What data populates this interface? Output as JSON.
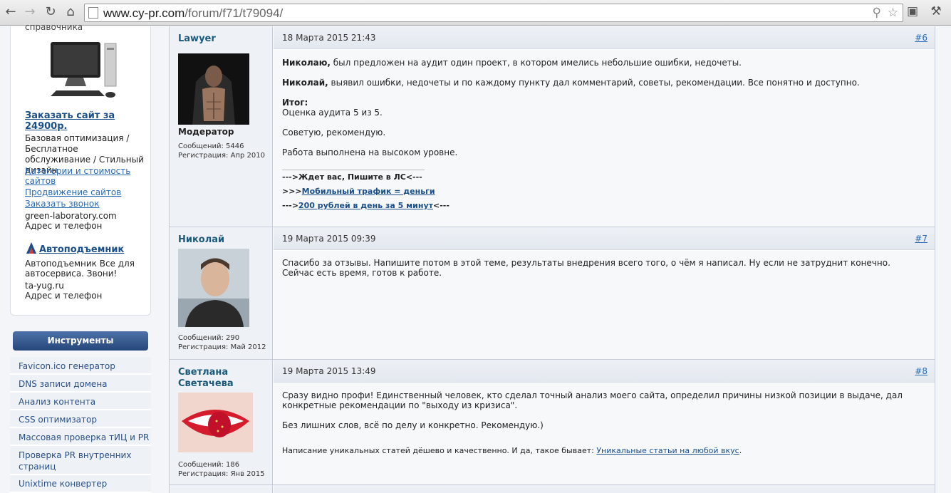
{
  "browser": {
    "url_host": "www.cy-pr.com",
    "url_path": "/forum/f71/t79094/"
  },
  "sidebar": {
    "cut_text": "справочника",
    "ad1": {
      "title": "Заказать сайт за 24900р.",
      "desc": "Базовая оптимизация / Бесплатное обслуживание / Стильный дизайн",
      "links": [
        "Категории и стоимость сайтов",
        "Продвижение сайтов",
        "Заказать звонок"
      ],
      "domain": "green-laboratory.com",
      "contact": "Адрес и телефон"
    },
    "ad2": {
      "title": "Автоподъемник",
      "desc": "Автоподъемник Все для автосервиса. Звони!",
      "domain": "ta-yug.ru",
      "contact": "Адрес и телефон"
    },
    "tools_header": "Инструменты",
    "tools": [
      "Favicon.ico генератор",
      "DNS записи домена",
      "Анализ контента",
      "CSS оптимизатор",
      "Массовая проверка тИЦ и PR",
      "Проверка PR внутренних страниц",
      "Unixtime конвертер"
    ]
  },
  "posts": [
    {
      "author": "Lawyer",
      "role": "Модератор",
      "messages": "Сообщений: 5446",
      "registered": "Регистрация: Апр 2010",
      "date": "18 Марта 2015 21:43",
      "number": "#6",
      "p1_bold": "Николаю,",
      "p1": " был предложен на аудит один проект, в котором имелись небольшие ошибки, недочеты.",
      "p2_bold": "Николай,",
      "p2": " выявил ошибки, недочеты и по каждому пункту дал комментарий, советы, рекомендации. Все понятно и доступно.",
      "p3_bold": "Итог:",
      "p3": "Оценка аудита 5 из 5.",
      "p4": "Советую, рекомендую.",
      "p5": "Работа выполнена на высоком уровне.",
      "sig1": "--->Ждет вас, Пишите в ЛС<---",
      "sig2_pre": ">>>",
      "sig2_link": "Мобильный трафик = деньги",
      "sig3_pre": "--->",
      "sig3_link": "200 рублей в день за 5 минут",
      "sig3_post": "<---"
    },
    {
      "author": "Николай",
      "messages": "Сообщений: 290",
      "registered": "Регистрация: Май 2012",
      "date": "19 Марта 2015 09:39",
      "number": "#7",
      "p1": "Спасибо за отзывы. Напишите потом в этой теме, результаты внедрения всего того, о чём я написал. Ну если не затруднит конечно. Сейчас есть время, готов к работе."
    },
    {
      "author": "Светлана Светачева",
      "messages": "Сообщений: 186",
      "registered": "Регистрация: Янв 2015",
      "date": "19 Марта 2015 13:49",
      "number": "#8",
      "p1": "Сразу видно профи! Единственный человек, кто сделал точный анализ моего сайта, определил причины низкой позиции в выдаче, дал конкретные рекомендации по \"выходу из кризиса\".",
      "p2": "Без лишних слов, всё по делу и конкретно. Рекомендую.)",
      "sig_pre": "Написание уникальных статей дёшево и качественно. И да, такое бывает: ",
      "sig_link": "Уникальные статьи на любой вкус",
      "sig_post": "."
    }
  ]
}
